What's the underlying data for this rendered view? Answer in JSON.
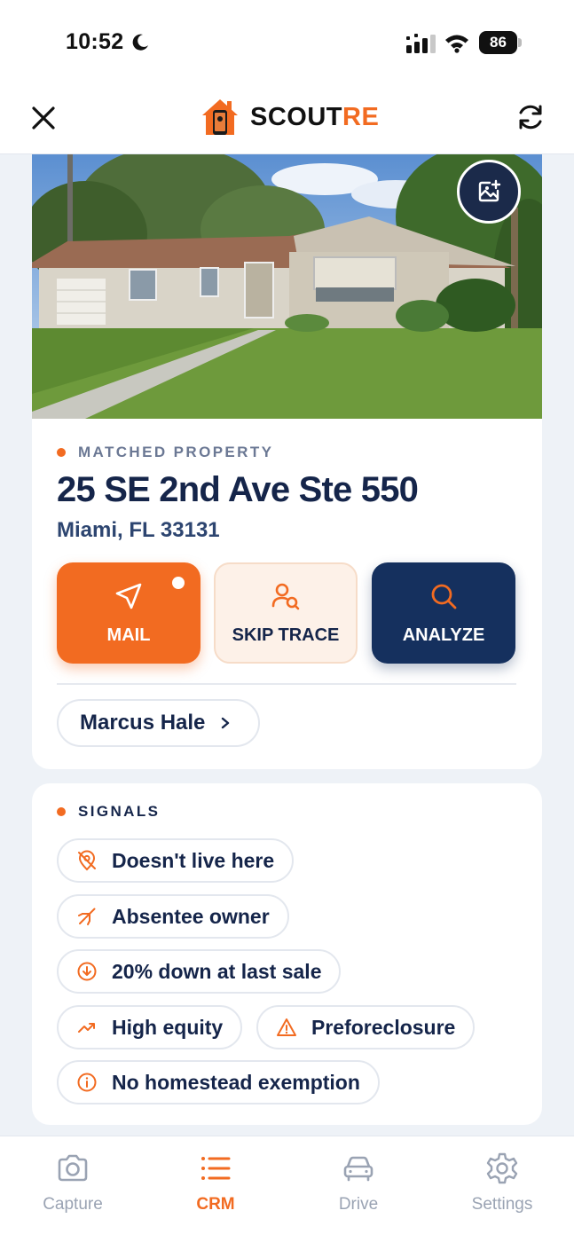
{
  "status": {
    "time": "10:52",
    "battery": "86"
  },
  "header": {
    "brand_part1": "SCOUT",
    "brand_part2": "RE"
  },
  "property": {
    "label": "MATCHED PROPERTY",
    "address": "25 SE 2nd Ave Ste 550",
    "city": "Miami, FL 33131"
  },
  "actions": {
    "mail": "MAIL",
    "skip_trace": "SKIP TRACE",
    "analyze": "ANALYZE"
  },
  "owner": {
    "name": "Marcus Hale"
  },
  "signals": {
    "label": "SIGNALS",
    "items": [
      {
        "label": "Doesn't live here",
        "icon": "location-off-icon"
      },
      {
        "label": "Absentee owner",
        "icon": "plane-icon"
      },
      {
        "label": "20% down at last sale",
        "icon": "arrow-down-circle-icon"
      },
      {
        "label": "High equity",
        "icon": "trending-up-icon"
      },
      {
        "label": "Preforeclosure",
        "icon": "warning-icon"
      },
      {
        "label": "No homestead exemption",
        "icon": "info-icon"
      }
    ]
  },
  "tabs": [
    {
      "label": "Capture",
      "icon": "camera-icon",
      "active": false
    },
    {
      "label": "CRM",
      "icon": "list-icon",
      "active": true
    },
    {
      "label": "Drive",
      "icon": "car-icon",
      "active": false
    },
    {
      "label": "Settings",
      "icon": "gear-icon",
      "active": false
    }
  ],
  "colors": {
    "accent": "#f26b21",
    "navy": "#15305e",
    "text": "#15254a"
  }
}
